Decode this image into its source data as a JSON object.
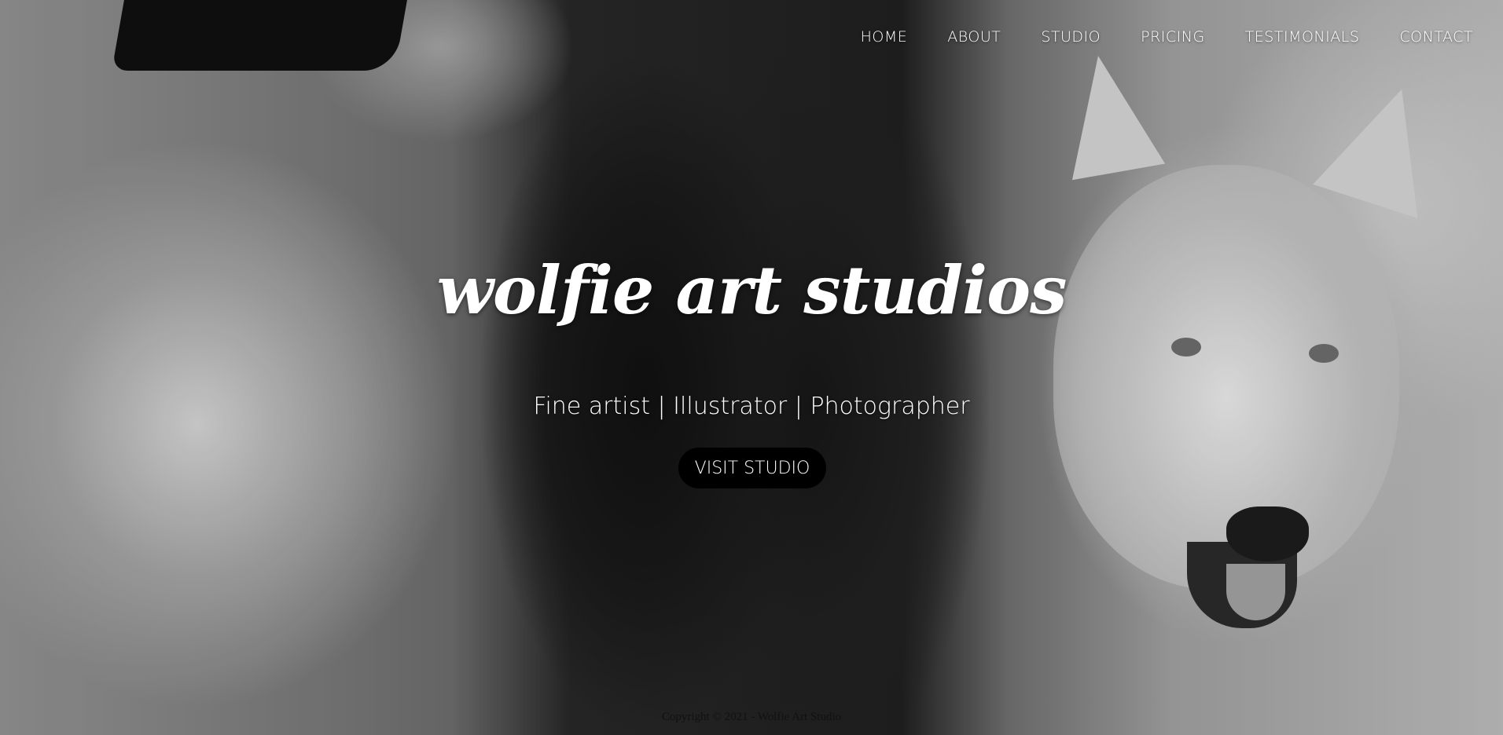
{
  "nav": {
    "items": [
      {
        "label": "HOME"
      },
      {
        "label": "ABOUT"
      },
      {
        "label": "STUDIO"
      },
      {
        "label": "PRICING"
      },
      {
        "label": "TESTIMONIALS"
      },
      {
        "label": "CONTACT"
      }
    ]
  },
  "hero": {
    "brand": "wolfie art studios",
    "tagline": "Fine artist | Illustrator | Photographer",
    "cta_label": "VISIT STUDIO",
    "background_description_colors": {
      "tone": "#7a7a7a",
      "dark": "#1a1a1a",
      "light": "#d3d3d3"
    }
  },
  "footer": {
    "copyright": "Copyright © 2021 - Wolfie Art Studio"
  }
}
